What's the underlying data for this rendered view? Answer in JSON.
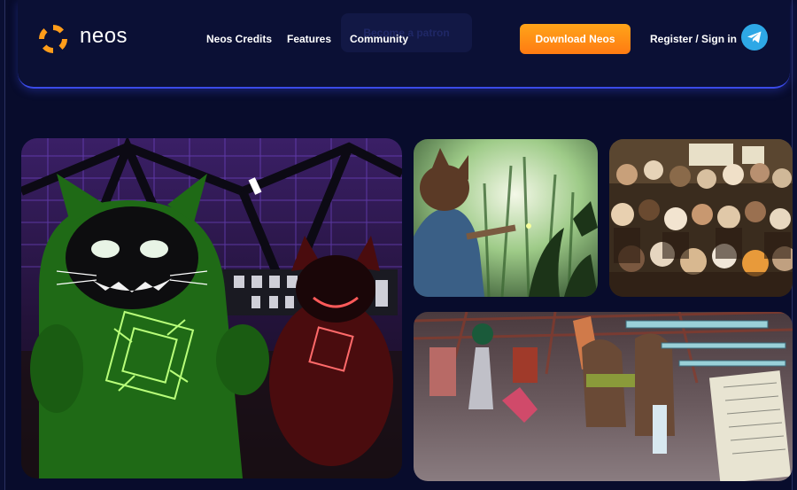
{
  "brand": {
    "name": "neos",
    "logo_icon": "neos-logo-icon"
  },
  "nav": {
    "links": [
      {
        "label": "Neos Credits"
      },
      {
        "label": "Features"
      },
      {
        "label": "Community"
      }
    ],
    "patron_label": "Become a patron",
    "download_label": "Download Neos",
    "signin_label": "Register / Sign in",
    "telegram_icon": "telegram-icon"
  },
  "colors": {
    "background": "#080c2c",
    "accent_border": "#3a4ae8",
    "download_button": "#ff8a14",
    "telegram": "#2ea8e6"
  },
  "gallery": [
    {
      "icon": "green-cat-avatar-image"
    },
    {
      "icon": "forest-scene-image"
    },
    {
      "icon": "avatar-crowd-image"
    },
    {
      "icon": "workshop-scene-image"
    }
  ]
}
